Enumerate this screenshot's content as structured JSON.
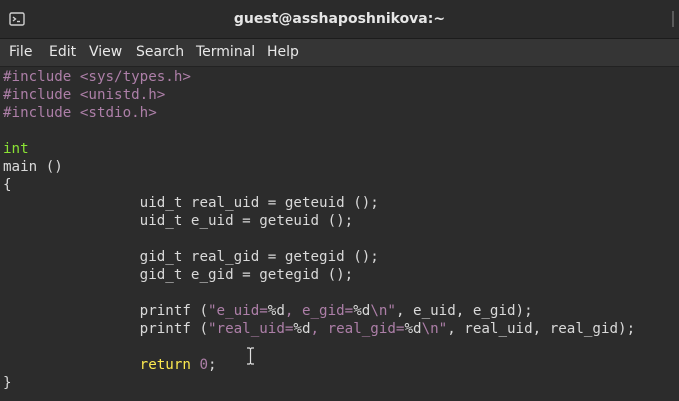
{
  "window": {
    "title": "guest@asshaposhnikova:~"
  },
  "menu": {
    "items": [
      "File",
      "Edit",
      "View",
      "Search",
      "Terminal",
      "Help"
    ]
  },
  "code": {
    "l1_kw": "#include",
    "l1_rest": " <sys/types.h>",
    "l2_kw": "#include",
    "l2_rest": " <unistd.h>",
    "l3_kw": "#include",
    "l3_rest": " <stdio.h>",
    "l5_type": "int",
    "l6": "main ()",
    "l7": "{",
    "l8": "                uid_t real_uid = geteuid ();",
    "l9": "                uid_t e_uid = geteuid ();",
    "l11": "                gid_t real_gid = getegid ();",
    "l12": "                gid_t e_gid = getegid ();",
    "l14_a": "                printf (",
    "l14_s1": "\"e_uid=",
    "l14_f1": "%d",
    "l14_s2": ", e_gid=",
    "l14_f2": "%d",
    "l14_s3": "\\n\"",
    "l14_b": ", e_uid, e_gid);",
    "l15_a": "                printf (",
    "l15_s1": "\"real_uid=",
    "l15_f1": "%d",
    "l15_s2": ", real_gid=",
    "l15_f2": "%d",
    "l15_s3": "\\n\"",
    "l15_b": ", real_uid, real_gid);",
    "l17_indent": "                ",
    "l17_ret": "return",
    "l17_sp": " ",
    "l17_num": "0",
    "l17_end": ";",
    "l18": "}"
  },
  "colors": {
    "preprocessor": "#ad7fa8",
    "type": "#8ae234",
    "keyword": "#fce94f",
    "text": "#d9d9d9",
    "background": "#2c2c2c"
  },
  "icons": [
    "terminal-icon",
    "text-cursor-icon"
  ]
}
